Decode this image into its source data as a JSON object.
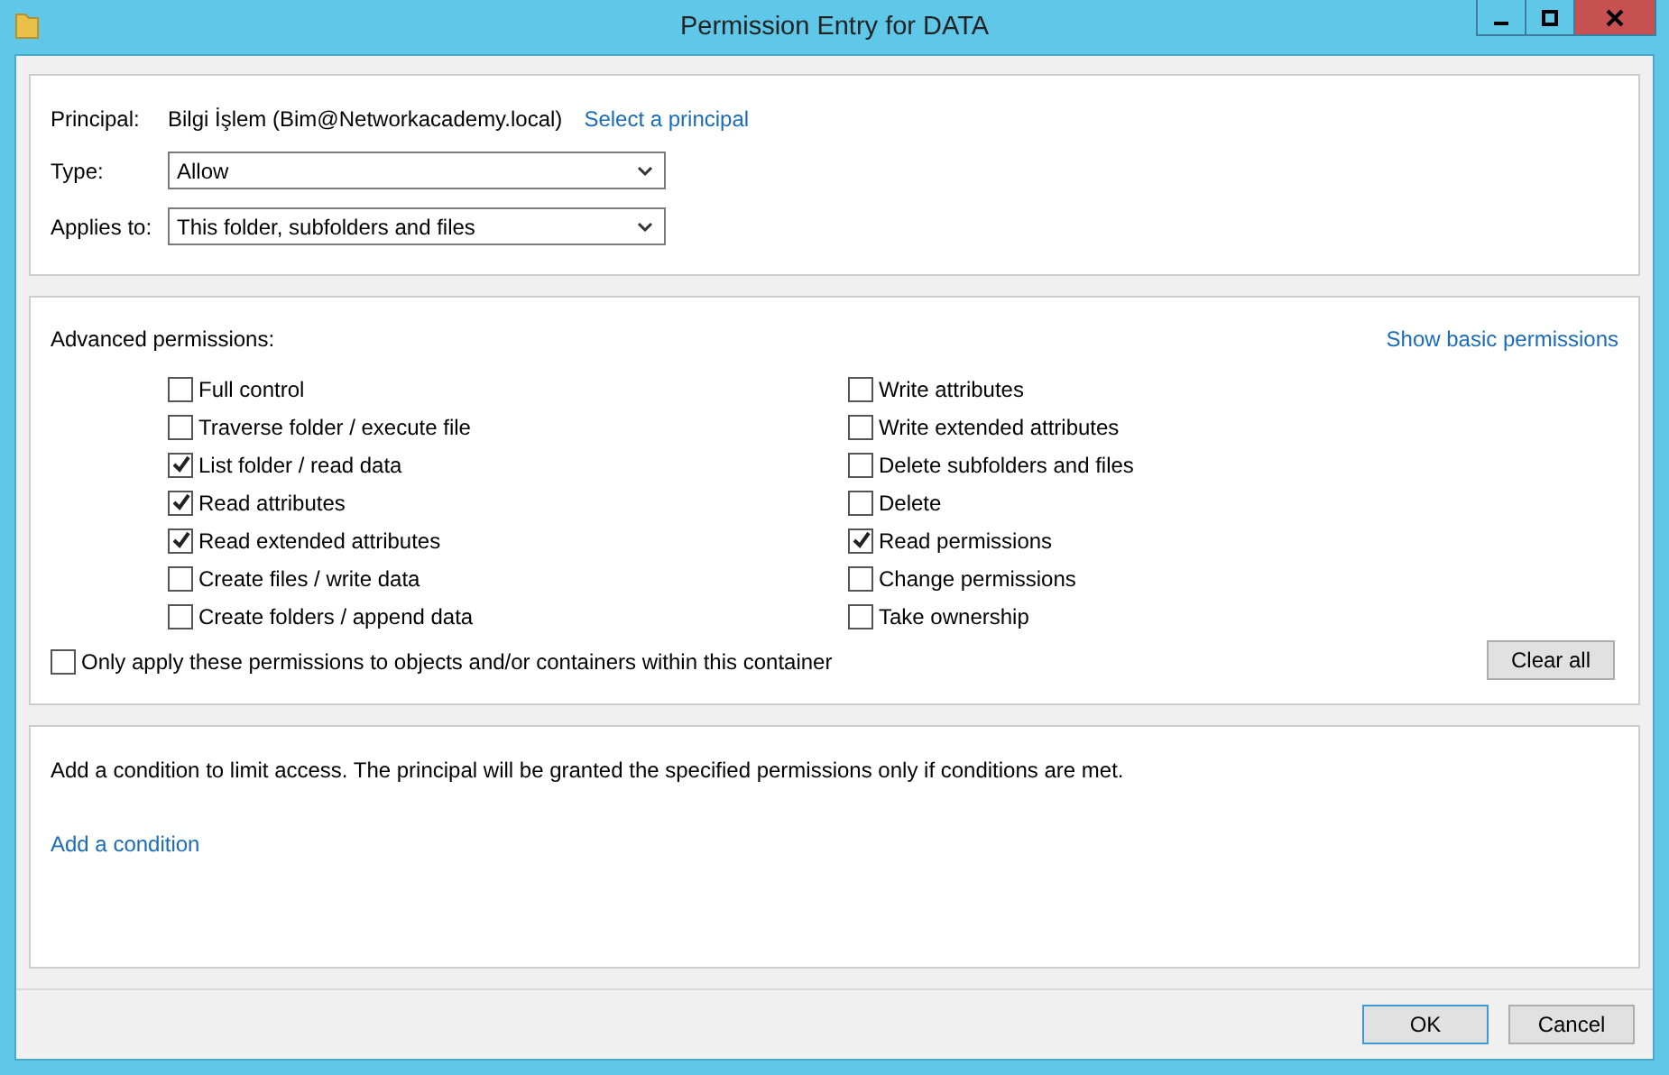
{
  "window": {
    "title": "Permission Entry for DATA"
  },
  "principal": {
    "label": "Principal:",
    "value": "Bilgi İşlem (Bim@Networkacademy.local)",
    "link": "Select a principal"
  },
  "type": {
    "label": "Type:",
    "value": "Allow"
  },
  "applies_to": {
    "label": "Applies to:",
    "value": "This folder, subfolders and files"
  },
  "advanced": {
    "label": "Advanced permissions:",
    "link": "Show basic permissions",
    "permissions_left": [
      {
        "label": "Full control",
        "checked": false
      },
      {
        "label": "Traverse folder / execute file",
        "checked": false
      },
      {
        "label": "List folder / read data",
        "checked": true
      },
      {
        "label": "Read attributes",
        "checked": true
      },
      {
        "label": "Read extended attributes",
        "checked": true
      },
      {
        "label": "Create files / write data",
        "checked": false
      },
      {
        "label": "Create folders / append data",
        "checked": false
      }
    ],
    "permissions_right": [
      {
        "label": "Write attributes",
        "checked": false
      },
      {
        "label": "Write extended attributes",
        "checked": false
      },
      {
        "label": "Delete subfolders and files",
        "checked": false
      },
      {
        "label": "Delete",
        "checked": false
      },
      {
        "label": "Read permissions",
        "checked": true
      },
      {
        "label": "Change permissions",
        "checked": false
      },
      {
        "label": "Take ownership",
        "checked": false
      }
    ],
    "only_apply": {
      "label": "Only apply these permissions to objects and/or containers within this container",
      "checked": false
    },
    "clear_button": "Clear all"
  },
  "condition": {
    "text": "Add a condition to limit access. The principal will be granted the specified permissions only if conditions are met.",
    "link": "Add a condition"
  },
  "buttons": [
    {
      "label": "OK",
      "default": true
    },
    {
      "label": "Cancel",
      "default": false
    }
  ]
}
